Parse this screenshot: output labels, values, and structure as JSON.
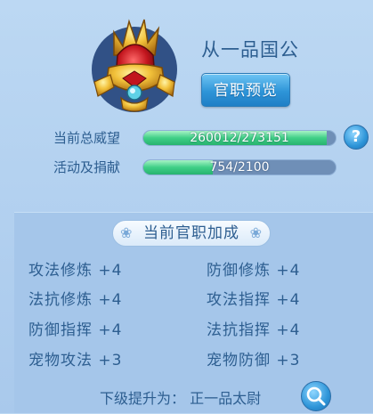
{
  "rank": {
    "title": "从一品国公",
    "preview_button": "官职预览"
  },
  "stats": [
    {
      "label": "当前总威望",
      "value": "260012/273151",
      "progress": 0.952
    },
    {
      "label": "活动及捐献",
      "value": "754/2100",
      "progress": 0.359
    }
  ],
  "help_icon": "?",
  "bonus": {
    "header": "当前官职加成",
    "items": [
      "攻法修炼 +4",
      "防御修炼 +4",
      "法抗修炼 +4",
      "攻法指挥 +4",
      "防御指挥 +4",
      "法抗指挥 +4",
      "宠物攻法 +3",
      "宠物防御 +3"
    ]
  },
  "promotion": {
    "label": "下级提升为：",
    "next_rank": "正一品太尉"
  },
  "colors": {
    "text": "#2d5e90",
    "progress_green": "#3fcf86",
    "button_blue": "#2e95d8"
  }
}
